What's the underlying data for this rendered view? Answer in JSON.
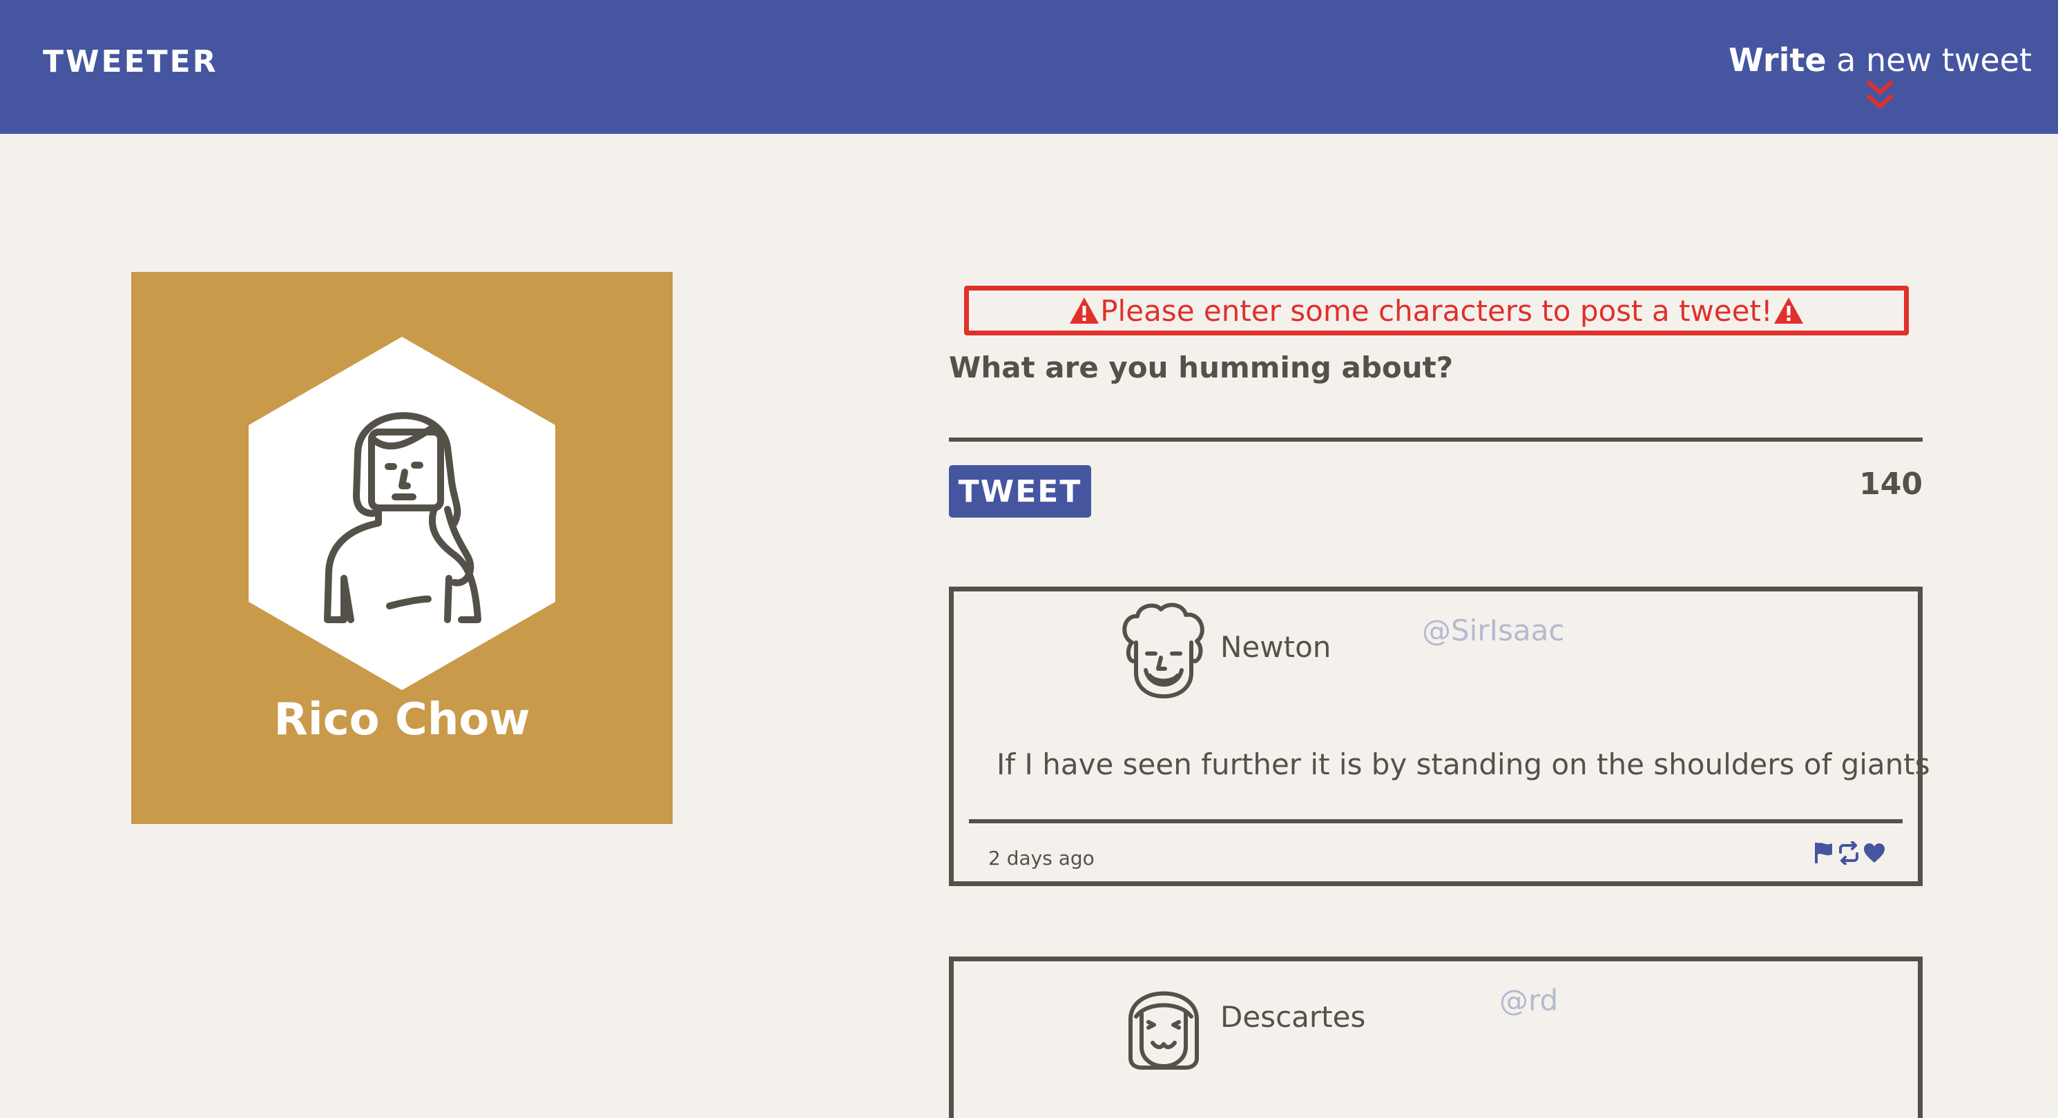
{
  "nav": {
    "brand": "TWEETER",
    "compose_bold": "Write",
    "compose_rest": " a new tweet",
    "background": "#4555a0"
  },
  "profile": {
    "name": "Rico Chow",
    "background": "#c99a4a"
  },
  "composer": {
    "error": "Please enter some characters to post a tweet!",
    "prompt": "What are you humming about?",
    "button_label": "TWEET",
    "counter": "140",
    "error_color": "#e0302a"
  },
  "tweets": [
    {
      "author": "Newton",
      "handle": "@SirIsaac",
      "text": "If I have seen further it is by standing on the shoulders of giants",
      "timestamp": "2 days ago",
      "actions": [
        "flag-icon",
        "retweet-icon",
        "heart-icon"
      ]
    },
    {
      "author": "Descartes",
      "handle": "@rd"
    }
  ]
}
